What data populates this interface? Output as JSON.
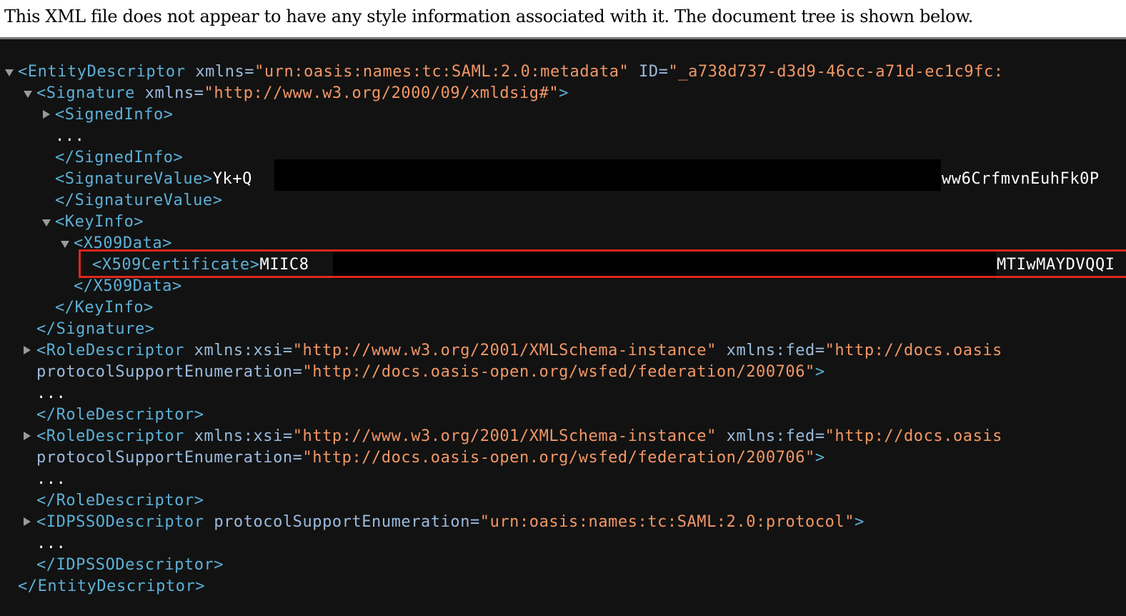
{
  "banner": {
    "message": "This XML file does not appear to have any style information associated with it. The document tree is shown below."
  },
  "tree": {
    "entity_open": {
      "name": "<EntityDescriptor",
      "attr1": " xmlns=",
      "val1": "\"urn:oasis:names:tc:SAML:2.0:metadata\"",
      "attr2": " ID=",
      "val2": "\"_a738d737-d3d9-46cc-a71d-ec1c9fc:"
    },
    "signature_open": {
      "name": "<Signature",
      "attr": " xmlns=",
      "val": "\"http://www.w3.org/2000/09/xmldsig#\"",
      "close": ">"
    },
    "signedinfo_open": "<SignedInfo>",
    "ellipsis": "...",
    "signedinfo_close": "</SignedInfo>",
    "signaturevalue_open": "<SignatureValue>",
    "signaturevalue_text_start": "Yk+Q",
    "signaturevalue_text_end": "ww6CrfmvnEuhFk0P",
    "signaturevalue_close": "</SignatureValue>",
    "keyinfo_open": "<KeyInfo>",
    "x509data_open": "<X509Data>",
    "x509cert_open": "<X509Certificate>",
    "x509cert_text_start": "MIIC8",
    "x509cert_text_end": "MTIwMAYDVQQI",
    "x509data_close": "</X509Data>",
    "keyinfo_close": "</KeyInfo>",
    "signature_close": "</Signature>",
    "role1": {
      "name": "<RoleDescriptor",
      "attr1": " xmlns:xsi=",
      "val1": "\"http://www.w3.org/2001/XMLSchema-instance\"",
      "attr2": " xmlns:fed=",
      "val2": "\"http://docs.oasis",
      "attr3": "protocolSupportEnumeration=",
      "val3": "\"http://docs.oasis-open.org/wsfed/federation/200706\"",
      "gt": ">",
      "close": "</RoleDescriptor>"
    },
    "role2": {
      "name": "<RoleDescriptor",
      "attr1": " xmlns:xsi=",
      "val1": "\"http://www.w3.org/2001/XMLSchema-instance\"",
      "attr2": " xmlns:fed=",
      "val2": "\"http://docs.oasis",
      "attr3": "protocolSupportEnumeration=",
      "val3": "\"http://docs.oasis-open.org/wsfed/federation/200706\"",
      "gt": ">",
      "close": "</RoleDescriptor>"
    },
    "idp": {
      "name": "<IDPSSODescriptor",
      "attr": " protocolSupportEnumeration=",
      "val": "\"urn:oasis:names:tc:SAML:2.0:protocol\"",
      "gt": ">",
      "close": "</IDPSSODescriptor>"
    },
    "entity_close": "</EntityDescriptor>"
  }
}
